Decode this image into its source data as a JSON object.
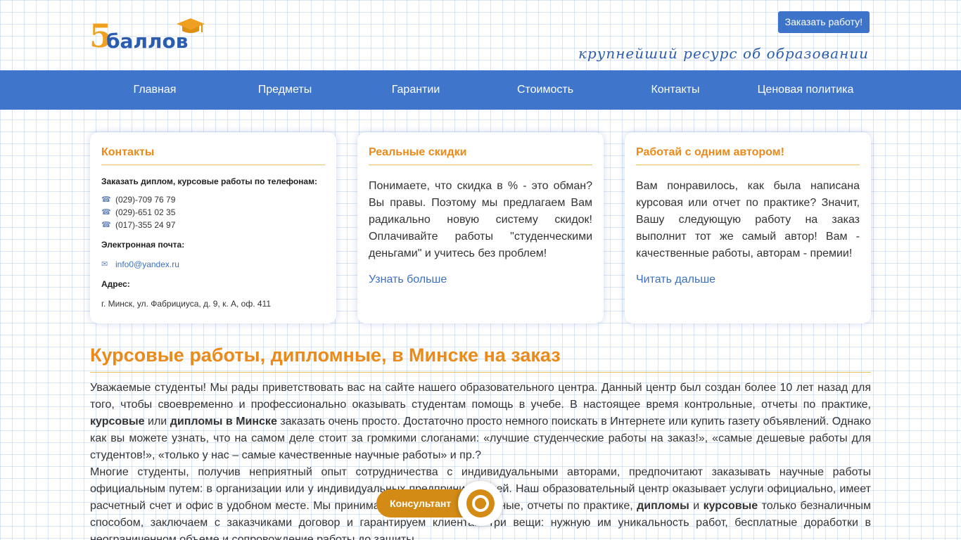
{
  "header": {
    "logo_five": "5",
    "logo_text": "баллов",
    "order_button": "Заказать работу!",
    "slogan": "крупнейший ресурс об образовании"
  },
  "nav": {
    "items": [
      "Главная",
      "Предметы",
      "Гарантии",
      "Стоимость",
      "Контакты",
      "Ценовая политика"
    ]
  },
  "cards": {
    "contacts": {
      "title": "Контакты",
      "phones_label": "Заказать диплом, курсовые работы по телефонам:",
      "phones": [
        "(029)-709 76 79",
        "(029)-651 02 35",
        "(017)-355 24 97"
      ],
      "email_label": "Электронная почта:",
      "email": "info0@yandex.ru",
      "address_label": "Адрес:",
      "address": "г. Минск, ул. Фабрициуса, д. 9, к. А, оф. 411"
    },
    "discounts": {
      "title": "Реальные скидки",
      "text": "Понимаете, что скидка в % - это обман? Вы правы. Поэтому мы предлагаем Вам радикально новую систему скидок! Оплачивайте работы \"студенческими деньгами\" и учитесь без проблем!",
      "link": "Узнать больше"
    },
    "author": {
      "title": "Работай с одним автором!",
      "text": "Вам понравилось, как была написана курсовая или отчет по практике? Значит, Вашу следующую работу на заказ выполнит тот же самый автор! Вам - качественные работы, авторам - премии!",
      "link": "Читать дальше"
    }
  },
  "main": {
    "title": "Курсовые работы, дипломные, в Минске на заказ",
    "p1_a": "Уважаемые студенты! Мы рады приветствовать вас на сайте нашего образовательного центра. Данный центр был создан более 10 лет назад для того, чтобы своевременно и профессионально оказывать студентам помощь в учебе. В настоящее время контрольные, отчеты по практике, ",
    "p1_b1": "курсовые",
    "p1_c": " или ",
    "p1_b2": "дипломы в Минске",
    "p1_d": " заказать очень просто. Достаточно просто немного поискать в Интернете или купить газету объявлений. Однако как вы можете узнать, что на самом деле стоит за громкими слоганами: «лучшие студенческие работы на заказ!», «самые дешевые работы для студентов!», «только у нас – самые качественные научные работы» и пр.?",
    "p2_a": "Многие студенты, получив неприятный опыт сотрудничества с индивидуальными авторами, предпочитают заказывать научные работы официальным путем: в организации или у индивидуальных предпринимателей. Наш образовательный центр оказывает услуги официально, имеет расчетный счет и офис в удобном месте. Мы принимаем оплату за контрольные, отчеты по практике, ",
    "p2_b1": "дипломы",
    "p2_c": " и ",
    "p2_b2": "курсовые",
    "p2_d": " только безналичным способом, заключаем с заказчиками договор и гарантируем клиентам три вещи: нужную им уникальность работ, бесплатные доработки в неограниченном объеме и сопровождение работы до защиты."
  },
  "consultant": {
    "label": "Консультант"
  },
  "colors": {
    "nav_bg": "#3f76cb",
    "accent_orange": "#ea8a1a",
    "link_blue": "#3d6fc0",
    "consult_bg": "#d38b15"
  }
}
